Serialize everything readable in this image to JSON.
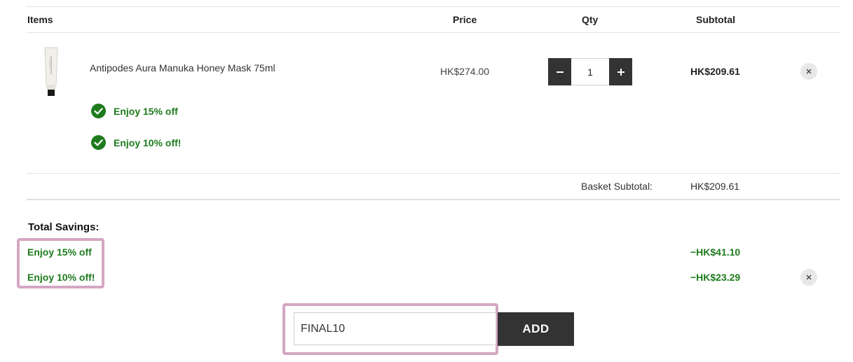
{
  "table": {
    "headers": {
      "items": "Items",
      "price": "Price",
      "qty": "Qty",
      "subtotal": "Subtotal"
    }
  },
  "item": {
    "name": "Antipodes Aura Manuka Honey Mask 75ml",
    "price": "HK$274.00",
    "quantity": "1",
    "subtotal": "HK$209.61",
    "promotions": [
      {
        "label": "Enjoy 15% off"
      },
      {
        "label": "Enjoy 10% off!"
      }
    ]
  },
  "basket": {
    "subtotal_label": "Basket Subtotal:",
    "subtotal_value": "HK$209.61"
  },
  "savings": {
    "title": "Total Savings:",
    "rows": [
      {
        "name": "Enjoy 15% off",
        "amount": "−HK$41.10"
      },
      {
        "name": "Enjoy 10% off!",
        "amount": "−HK$23.29"
      }
    ]
  },
  "discount": {
    "code_value": "FINAL10",
    "add_label": "ADD"
  },
  "colors": {
    "promo_green": "#1e7b1e",
    "dark_button": "#333333",
    "highlight": "#d4a7c3"
  },
  "icons": {
    "check": "check-circle-icon",
    "remove": "close-icon",
    "minus": "minus-icon",
    "plus": "plus-icon"
  }
}
